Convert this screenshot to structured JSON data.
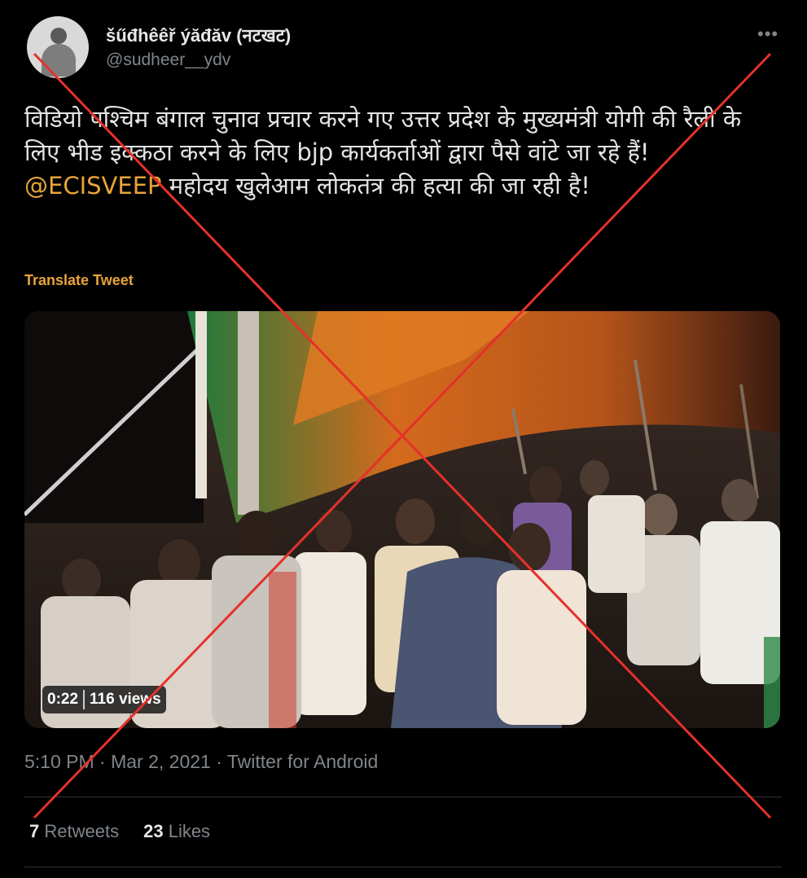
{
  "author": {
    "display_name": "šűđhêêř ýăđăv (नटखट)",
    "username": "@sudheer__ydv"
  },
  "tweet": {
    "text_before_mention": "विडियो पश्चिम बंगाल चुनाव प्रचार करने गए उत्तर प्रदेश के मुख्यमंत्री योगी की रैली के लिए भीड इक्कठा करने के लिए bjp कार्यकर्ताओं द्वारा पैसे वांटे जा रहे हैं! ",
    "mention": "@ECISVEEP",
    "text_after_mention": " महोदय खुलेआम लोकतंत्र की हत्या की जा रही है!",
    "translate_label": "Translate Tweet"
  },
  "video": {
    "duration": "0:22",
    "views": "116 views"
  },
  "meta": {
    "time": "5:10 PM",
    "separator": "·",
    "date": "Mar 2, 2021",
    "source": "Twitter for Android"
  },
  "stats": {
    "retweets_count": "7",
    "retweets_label": "Retweets",
    "likes_count": "23",
    "likes_label": "Likes"
  },
  "icons": {
    "more": "more-options-icon",
    "overlay": "red-cross-overlay"
  },
  "colors": {
    "background": "#000000",
    "accent": "#e8a43a",
    "cross": "#e5312b",
    "muted": "#7f858a"
  }
}
